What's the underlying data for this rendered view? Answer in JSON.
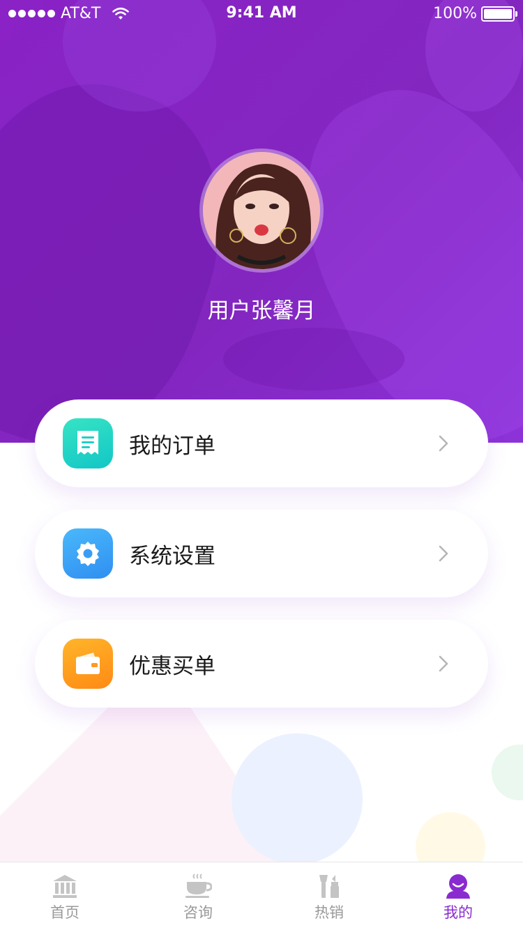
{
  "status_bar": {
    "carrier": "AT&T",
    "time": "9:41 AM",
    "battery": "100%"
  },
  "profile": {
    "username": "用户张馨月"
  },
  "menu": {
    "items": [
      {
        "label": "我的订单",
        "icon": "receipt-icon",
        "color": "#20d6c4"
      },
      {
        "label": "系统设置",
        "icon": "gear-icon",
        "color": "#3aa6f8"
      },
      {
        "label": "优惠买单",
        "icon": "wallet-icon",
        "color": "#ff9c1c"
      }
    ]
  },
  "tab_bar": {
    "tabs": [
      {
        "label": "首页",
        "icon": "bank-icon",
        "active": false
      },
      {
        "label": "咨询",
        "icon": "coffee-cup-icon",
        "active": false
      },
      {
        "label": "热销",
        "icon": "cosmetics-icon",
        "active": false
      },
      {
        "label": "我的",
        "icon": "user-icon",
        "active": true
      }
    ]
  },
  "colors": {
    "header": "#8a22c6",
    "accent": "#8a2bd0",
    "inactive": "#999999"
  }
}
